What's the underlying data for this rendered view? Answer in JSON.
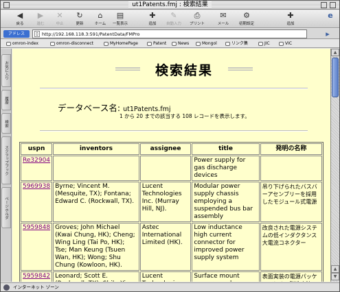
{
  "window": {
    "title": "ut1Patents.fmj : 検索結果"
  },
  "toolbar": {
    "back": "戻る",
    "forward": "進む",
    "stop": "中止",
    "refresh": "更新",
    "home": "ホーム",
    "sidebar": "一覧表示",
    "add": "追加",
    "autofill": "自動入力",
    "print": "プリント",
    "mail": "メール",
    "prefs": "初期設定",
    "add_right": "追加"
  },
  "address": {
    "label": "アドレス",
    "url": "http://192.168.118.3:591/PatentData/FMPro"
  },
  "favorites": [
    "omron-index",
    "omron-disconnect",
    "MyHomePage",
    "Patent",
    "News",
    "Mongol",
    "リンク集",
    "JIC",
    "VIC"
  ],
  "sidetabs": [
    "お気に入り",
    "履歴",
    "検索",
    "スクラップブック",
    "ページホルダ"
  ],
  "page": {
    "title": "検索結果",
    "db_label": "データベース名:",
    "db_name": "ut1Patents.fmj",
    "summary": "1 から 20 までの該当する 108 レコードを表示します。"
  },
  "table": {
    "headers": [
      "uspn",
      "inventors",
      "assignee",
      "title",
      "発明の名称"
    ],
    "rows": [
      {
        "uspn": "Re32904",
        "inventors": "",
        "assignee": "",
        "title": "Power supply for gas discharge devices",
        "jtitle": ""
      },
      {
        "uspn": "5969938",
        "inventors": "Byrne; Vincent M. (Mesquite, TX); Fontana; Edward C. (Rockwall, TX).",
        "assignee": "Lucent Technologies Inc. (Murray Hill, NJ).",
        "title": "Modular power supply chassis employing a suspended bus bar assembly",
        "jtitle": "吊り下げられたバスバーアセンブリーを採用したモジュール式電源"
      },
      {
        "uspn": "5959848",
        "inventors": "Groves; John Michael (Kwai Chung, HK); Cheng; Wing Ling (Tai Po, HK); Tse; Man Keung (Tsuen Wan, HK); Wong; Shu Chung (Kowloon, HK).",
        "assignee": "Astec International Limited (HK).",
        "title": "Low inductance high current connector for improved power supply system",
        "jtitle": "改良された電源システムの低インダクタンス大電流コネクター"
      },
      {
        "uspn": "5959842",
        "inventors": "Leonard; Scott E. (Rockwall, TX); Shih; Yi Teh (Richardson, TX); Woods,",
        "assignee": "Lucent Technologies Inc. (Murray",
        "title": "Surface mount power supply package and method",
        "jtitle": "表面実装の電源パッケージとその製造方法"
      }
    ]
  },
  "status": {
    "text": "インターネット ゾーン"
  }
}
